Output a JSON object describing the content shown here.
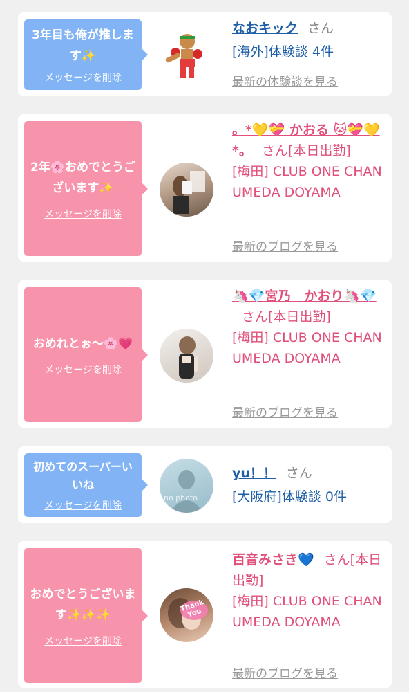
{
  "cards": [
    {
      "bubble_message": "3年目も俺が推します✨",
      "delete_label": "メッセージを削除",
      "name": "なおキック",
      "honorific": "さん",
      "detail": "[海外]体験談 4件",
      "more_link": "最新の体験談を見る"
    },
    {
      "bubble_message": "2年🌸おめでとうございます✨",
      "delete_label": "メッセージを削除",
      "name": "。*💛💝 かおる 🐱💝💛*。",
      "honorific": "さん[本日出勤]",
      "detail": "[梅田] CLUB ONE CHAN UMEDA DOYAMA",
      "more_link": "最新のブログを見る"
    },
    {
      "bubble_message": "おめれとぉ〜🌸💗",
      "delete_label": "メッセージを削除",
      "name": "🦄💎宮乃　かおり🦄💎",
      "honorific": "さん[本日出勤]",
      "detail": "[梅田] CLUB ONE CHAN UMEDA DOYAMA",
      "more_link": "最新のブログを見る"
    },
    {
      "bubble_message": "初めてのスーパーいいね",
      "delete_label": "メッセージを削除",
      "name": "yu！！",
      "honorific": "さん",
      "detail": "[大阪府]体験談 0件",
      "avatar_caption": "no photo"
    },
    {
      "bubble_message": "おめでとうございます✨✨✨",
      "delete_label": "メッセージを削除",
      "name": "百音みさき💙",
      "honorific": "さん[本日出勤]",
      "detail": "[梅田] CLUB ONE CHAN UMEDA DOYAMA",
      "more_link": "最新のブログを見る",
      "avatar_sticker": "Thank You"
    }
  ]
}
